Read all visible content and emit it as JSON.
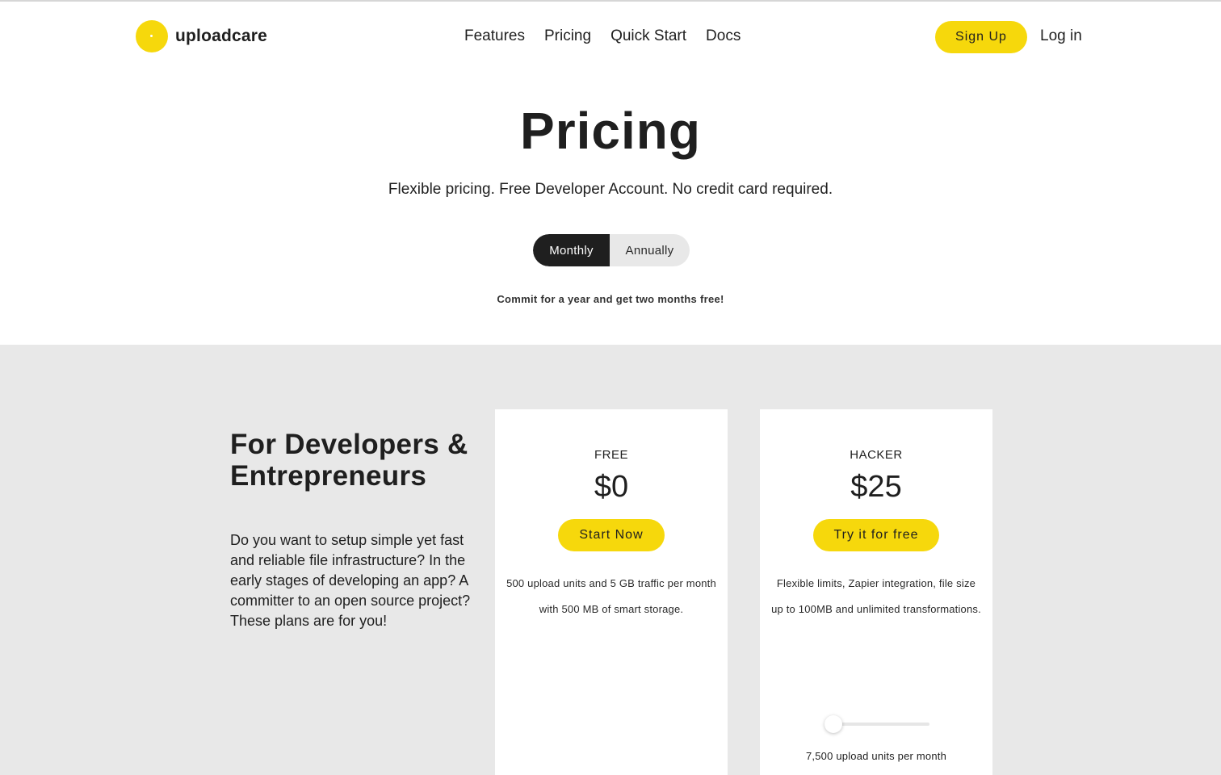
{
  "header": {
    "logo_text": "uploadcare",
    "nav": [
      "Features",
      "Pricing",
      "Quick Start",
      "Docs"
    ],
    "signup_label": "Sign Up",
    "login_label": "Log in"
  },
  "hero": {
    "title": "Pricing",
    "subtitle": "Flexible pricing. Free Developer Account. No credit card required.",
    "billing_toggle": {
      "options": [
        "Monthly",
        "Annually"
      ],
      "selected": "Monthly"
    },
    "commit_note": "Commit for a year and get two months free!"
  },
  "intro": {
    "title": "For Developers & Entrepreneurs",
    "text": "Do you want to setup simple yet fast and reliable file infrastructure? In the early stages of developing an app? A committer to an open source project? These plans are for you!"
  },
  "plans": [
    {
      "name": "FREE",
      "price": "$0",
      "button": "Start Now",
      "description": "500 upload units and 5 GB traffic per month with 500 MB of smart storage."
    },
    {
      "name": "HACKER",
      "price": "$25",
      "button": "Try it for free",
      "description": "Flexible limits, Zapier integration, file size up to 100MB and unlimited transformations.",
      "slider_value": 0,
      "slider_label": "7,500 upload units per month"
    }
  ],
  "colors": {
    "accent": "#f6d80c",
    "dark": "#1f1f1f",
    "section_bg": "#e8e8e8"
  }
}
